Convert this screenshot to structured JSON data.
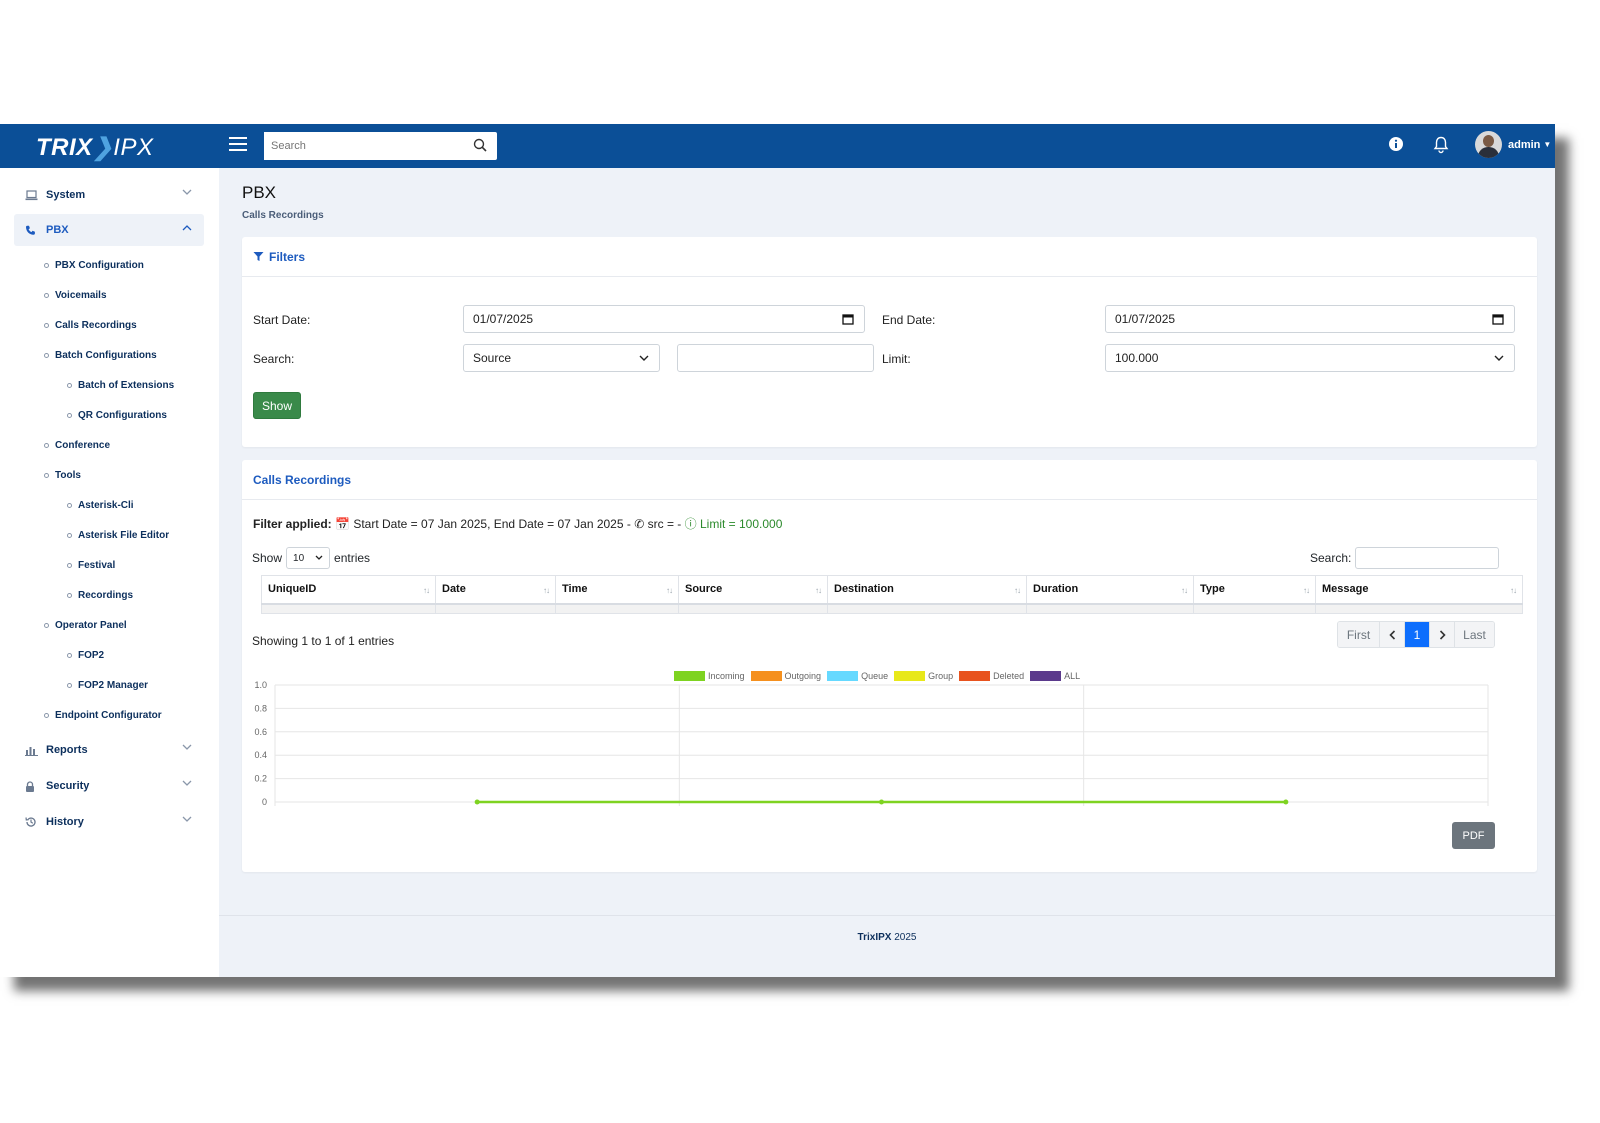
{
  "brand": {
    "logo_a": "TRIX",
    "logo_b": "IPX"
  },
  "topbar": {
    "search_placeholder": "Search",
    "user_name": "admin"
  },
  "sidebar": {
    "system": "System",
    "pbx": "PBX",
    "pbx_items": {
      "pbx_configuration": "PBX Configuration",
      "voicemails": "Voicemails",
      "calls_recordings": "Calls Recordings",
      "batch_configurations": "Batch Configurations",
      "batch_of_extensions": "Batch of Extensions",
      "qr_configurations": "QR Configurations",
      "conference": "Conference",
      "tools": "Tools",
      "asterisk_cli": "Asterisk-Cli",
      "asterisk_file_editor": "Asterisk File Editor",
      "festival": "Festival",
      "recordings": "Recordings",
      "operator_panel": "Operator Panel",
      "fop2": "FOP2",
      "fop2_manager": "FOP2 Manager",
      "endpoint_configurator": "Endpoint Configurator"
    },
    "reports": "Reports",
    "security": "Security",
    "history": "History"
  },
  "page": {
    "title": "PBX",
    "subtitle": "Calls Recordings"
  },
  "filters": {
    "header": "Filters",
    "start_date_label": "Start Date:",
    "start_date_value": "01/07/2025",
    "end_date_label": "End Date:",
    "end_date_value": "01/07/2025",
    "search_label": "Search:",
    "search_field_value": "Source",
    "search_text_value": "",
    "limit_label": "Limit:",
    "limit_value": "100.000",
    "show_button": "Show"
  },
  "recordings": {
    "header": "Calls Recordings",
    "filter_prefix": "Filter applied:",
    "filter_dates": "Start Date = 07 Jan 2025, End Date = 07 Jan 2025 -",
    "filter_src": "src = -",
    "filter_limit": "Limit = 100.000",
    "show_label": "Show",
    "entries_value": "10",
    "entries_label": "entries",
    "search_label": "Search:",
    "columns": [
      "UniqueID",
      "Date",
      "Time",
      "Source",
      "Destination",
      "Duration",
      "Type",
      "Message"
    ],
    "showing": "Showing 1 to 1 of 1 entries",
    "pager": {
      "first": "First",
      "page": "1",
      "last": "Last"
    },
    "pdf_button": "PDF"
  },
  "chart_data": {
    "type": "line",
    "x": [
      "",
      "",
      ""
    ],
    "ylim": [
      0,
      1.0
    ],
    "y_ticks": [
      "1.0",
      "0.8",
      "0.6",
      "0.4",
      "0.2",
      "0"
    ],
    "legend_position": "top-center",
    "series": [
      {
        "name": "Incoming",
        "color": "#7ed321",
        "values": [
          0,
          0,
          0
        ]
      },
      {
        "name": "Outgoing",
        "color": "#f5901e",
        "values": []
      },
      {
        "name": "Queue",
        "color": "#66d9ff",
        "values": []
      },
      {
        "name": "Group",
        "color": "#e8e81a",
        "values": []
      },
      {
        "name": "Deleted",
        "color": "#e8531e",
        "values": []
      },
      {
        "name": "ALL",
        "color": "#5b3a8c",
        "values": []
      }
    ]
  },
  "footer": {
    "brand": "TrixIPX",
    "year": "2025"
  }
}
